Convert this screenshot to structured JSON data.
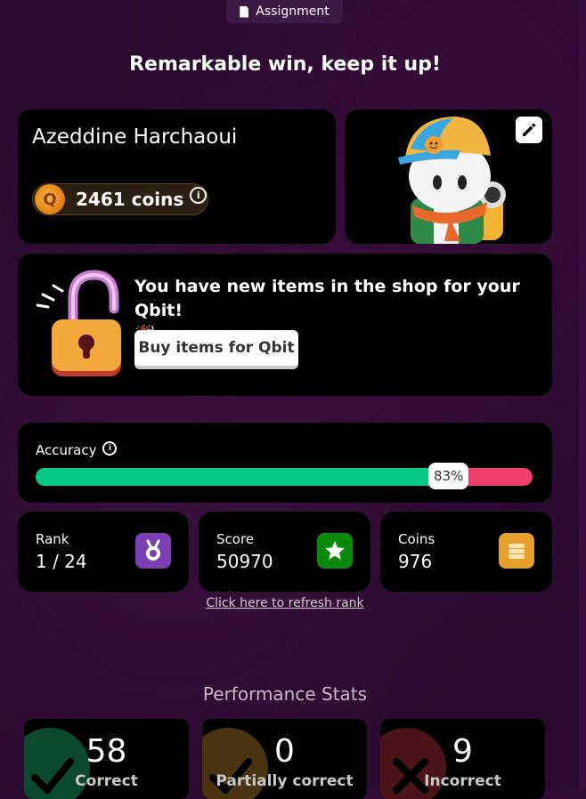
{
  "header": {
    "tag_label": "Assignment",
    "headline": "Remarkable win, keep it up!"
  },
  "profile": {
    "name": "Azeddine Harchaoui",
    "coins_label": "2461 coins"
  },
  "shop": {
    "message": "You have new items in the shop for your Qbit!",
    "emoji": "🎉",
    "button_label": "Buy items for Qbit"
  },
  "accuracy": {
    "label": "Accuracy",
    "value_text": "83%",
    "value": 0.83
  },
  "stats": [
    {
      "label": "Rank",
      "value": "1 / 24"
    },
    {
      "label": "Score",
      "value": "50970"
    },
    {
      "label": "Coins",
      "value": "976"
    }
  ],
  "refresh_link": "Click here to refresh rank",
  "performance": {
    "title": "Performance Stats",
    "items": [
      {
        "count": "58",
        "label": "Correct"
      },
      {
        "count": "0",
        "label": "Partially correct"
      },
      {
        "count": "9",
        "label": "Incorrect"
      }
    ]
  },
  "colors": {
    "correct": "#00c985",
    "incorrect": "#ee3f6b",
    "rank_badge": "#7b3fb3",
    "score_badge": "#0a8a0a",
    "coins_badge": "#e6a02c"
  },
  "icons": [
    "document-icon",
    "coin-icon",
    "info-icon",
    "edit-pencil-icon",
    "unlock-icon",
    "medal-icon",
    "star-icon",
    "coins-stack-icon",
    "check-icon",
    "cross-icon"
  ]
}
